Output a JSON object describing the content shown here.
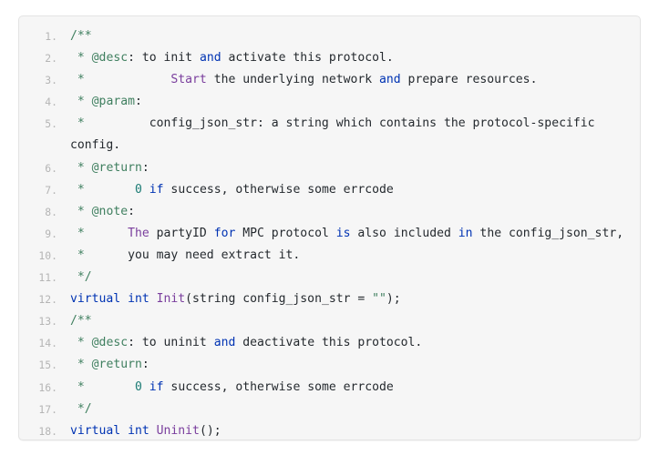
{
  "code_block": {
    "language": "cpp",
    "background_color": "#f6f6f6",
    "border_color": "#e3e3e3",
    "line_number_color": "#b5b5b5",
    "text_color": "#24292e",
    "token_colors": {
      "comment": "#3f7f5f",
      "keyword": "#0033b3",
      "function": "#7a3e9d",
      "number": "#1b7b74",
      "string": "#3f7f5f"
    },
    "lines": [
      {
        "number": "1",
        "tokens": [
          {
            "t": "/**",
            "c": "tok-cm"
          }
        ]
      },
      {
        "number": "2",
        "tokens": [
          {
            "t": " * ",
            "c": "tok-cm"
          },
          {
            "t": "@desc",
            "c": "tok-cm"
          },
          {
            "t": ": to init ",
            "c": "tok-txt"
          },
          {
            "t": "and",
            "c": "tok-kw"
          },
          {
            "t": " activate this protocol.",
            "c": "tok-txt"
          }
        ]
      },
      {
        "number": "3",
        "tokens": [
          {
            "t": " * ",
            "c": "tok-cm"
          },
          {
            "t": "           ",
            "c": "tok-txt"
          },
          {
            "t": "Start",
            "c": "tok-fn"
          },
          {
            "t": " the underlying network ",
            "c": "tok-txt"
          },
          {
            "t": "and",
            "c": "tok-kw"
          },
          {
            "t": " prepare resources.",
            "c": "tok-txt"
          }
        ]
      },
      {
        "number": "4",
        "tokens": [
          {
            "t": " * ",
            "c": "tok-cm"
          },
          {
            "t": "@param",
            "c": "tok-cm"
          },
          {
            "t": ":",
            "c": "tok-txt"
          }
        ]
      },
      {
        "number": "5",
        "tokens": [
          {
            "t": " * ",
            "c": "tok-cm"
          },
          {
            "t": "        config_json_str: a string which contains the protocol-specific config.",
            "c": "tok-txt"
          }
        ]
      },
      {
        "number": "6",
        "tokens": [
          {
            "t": " * ",
            "c": "tok-cm"
          },
          {
            "t": "@return",
            "c": "tok-cm"
          },
          {
            "t": ":",
            "c": "tok-txt"
          }
        ]
      },
      {
        "number": "7",
        "tokens": [
          {
            "t": " * ",
            "c": "tok-cm"
          },
          {
            "t": "      ",
            "c": "tok-txt"
          },
          {
            "t": "0",
            "c": "tok-num"
          },
          {
            "t": " ",
            "c": "tok-txt"
          },
          {
            "t": "if",
            "c": "tok-kw"
          },
          {
            "t": " success, otherwise some errcode",
            "c": "tok-txt"
          }
        ]
      },
      {
        "number": "8",
        "tokens": [
          {
            "t": " * ",
            "c": "tok-cm"
          },
          {
            "t": "@note",
            "c": "tok-cm"
          },
          {
            "t": ":",
            "c": "tok-txt"
          }
        ]
      },
      {
        "number": "9",
        "tokens": [
          {
            "t": " * ",
            "c": "tok-cm"
          },
          {
            "t": "     ",
            "c": "tok-txt"
          },
          {
            "t": "The",
            "c": "tok-fn"
          },
          {
            "t": " partyID ",
            "c": "tok-txt"
          },
          {
            "t": "for",
            "c": "tok-kw"
          },
          {
            "t": " MPC protocol ",
            "c": "tok-txt"
          },
          {
            "t": "is",
            "c": "tok-kw"
          },
          {
            "t": " also included ",
            "c": "tok-txt"
          },
          {
            "t": "in",
            "c": "tok-kw"
          },
          {
            "t": " the config_json_str,",
            "c": "tok-txt"
          }
        ]
      },
      {
        "number": "10",
        "tokens": [
          {
            "t": " * ",
            "c": "tok-cm"
          },
          {
            "t": "     you may need extract it.",
            "c": "tok-txt"
          }
        ]
      },
      {
        "number": "11",
        "tokens": [
          {
            "t": " */",
            "c": "tok-cm"
          }
        ]
      },
      {
        "number": "12",
        "tokens": [
          {
            "t": "virtual",
            "c": "tok-kw"
          },
          {
            "t": " ",
            "c": "tok-txt"
          },
          {
            "t": "int",
            "c": "tok-kw"
          },
          {
            "t": " ",
            "c": "tok-txt"
          },
          {
            "t": "Init",
            "c": "tok-fn"
          },
          {
            "t": "(string config_json_str = ",
            "c": "tok-txt"
          },
          {
            "t": "\"\"",
            "c": "tok-str"
          },
          {
            "t": ");",
            "c": "tok-txt"
          }
        ]
      },
      {
        "number": "13",
        "tokens": [
          {
            "t": "/**",
            "c": "tok-cm"
          }
        ]
      },
      {
        "number": "14",
        "tokens": [
          {
            "t": " * ",
            "c": "tok-cm"
          },
          {
            "t": "@desc",
            "c": "tok-cm"
          },
          {
            "t": ": to uninit ",
            "c": "tok-txt"
          },
          {
            "t": "and",
            "c": "tok-kw"
          },
          {
            "t": " deactivate this protocol.",
            "c": "tok-txt"
          }
        ]
      },
      {
        "number": "15",
        "tokens": [
          {
            "t": " * ",
            "c": "tok-cm"
          },
          {
            "t": "@return",
            "c": "tok-cm"
          },
          {
            "t": ":",
            "c": "tok-txt"
          }
        ]
      },
      {
        "number": "16",
        "tokens": [
          {
            "t": " * ",
            "c": "tok-cm"
          },
          {
            "t": "      ",
            "c": "tok-txt"
          },
          {
            "t": "0",
            "c": "tok-num"
          },
          {
            "t": " ",
            "c": "tok-txt"
          },
          {
            "t": "if",
            "c": "tok-kw"
          },
          {
            "t": " success, otherwise some errcode",
            "c": "tok-txt"
          }
        ]
      },
      {
        "number": "17",
        "tokens": [
          {
            "t": " */",
            "c": "tok-cm"
          }
        ]
      },
      {
        "number": "18",
        "tokens": [
          {
            "t": "virtual",
            "c": "tok-kw"
          },
          {
            "t": " ",
            "c": "tok-txt"
          },
          {
            "t": "int",
            "c": "tok-kw"
          },
          {
            "t": " ",
            "c": "tok-txt"
          },
          {
            "t": "Uninit",
            "c": "tok-fn"
          },
          {
            "t": "();",
            "c": "tok-txt"
          }
        ]
      }
    ]
  }
}
